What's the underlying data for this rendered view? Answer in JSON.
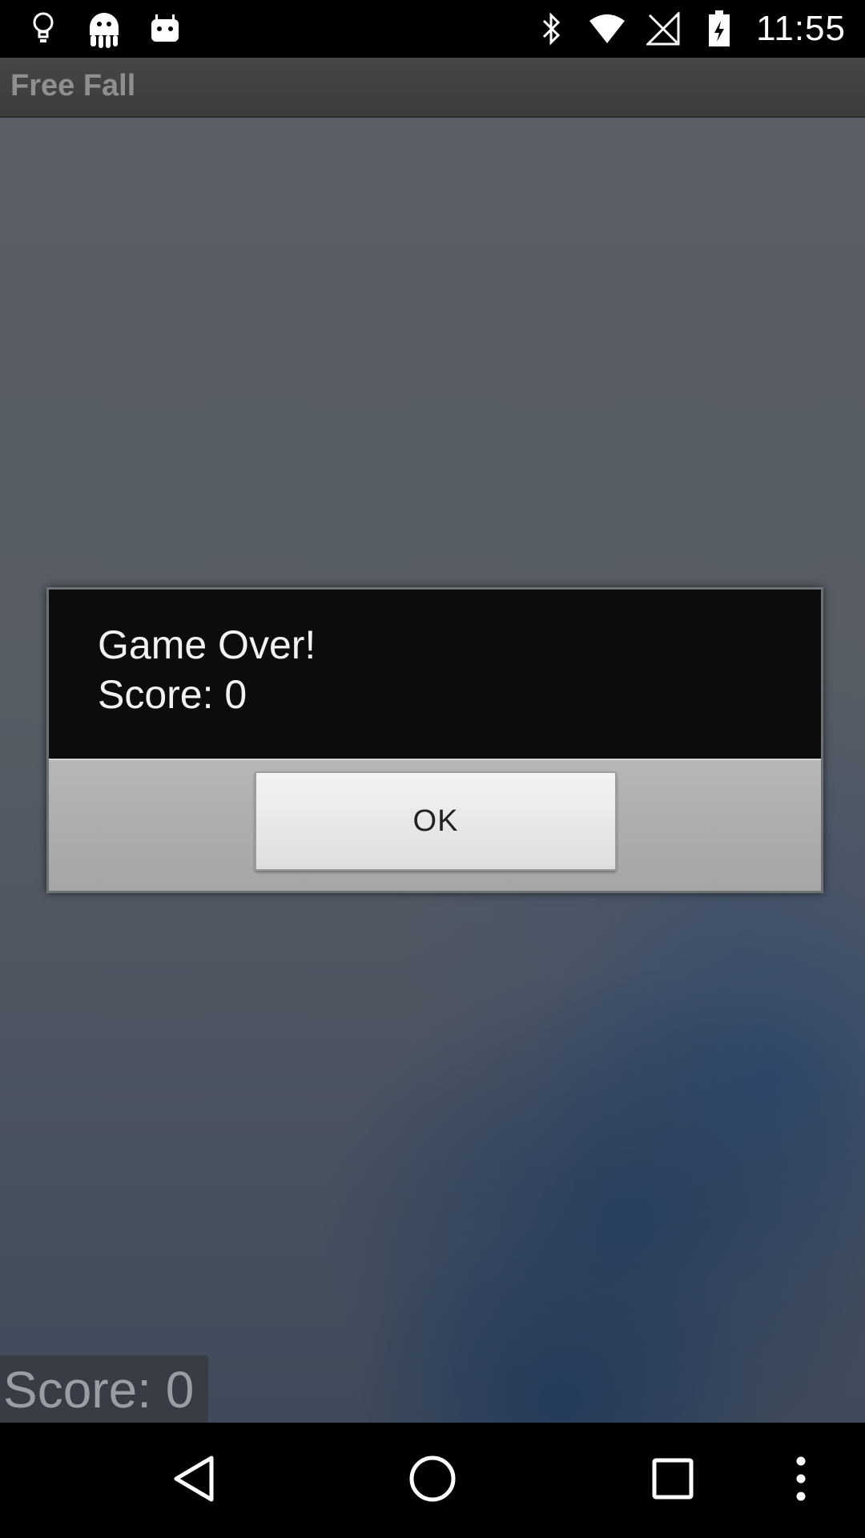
{
  "status_bar": {
    "time": "11:55",
    "left_icons": [
      "lightbulb-icon",
      "ghost-icon",
      "android-icon"
    ],
    "right_icons": [
      "bluetooth-icon",
      "wifi-icon",
      "signal-off-icon",
      "battery-charging-icon"
    ]
  },
  "action_bar": {
    "title": "Free Fall"
  },
  "game": {
    "score_label": "Score: 0"
  },
  "dialog": {
    "line1": "Game Over!",
    "line2": "Score: 0",
    "ok_label": "OK"
  },
  "nav_bar": {
    "buttons": [
      "back-icon",
      "home-icon",
      "recents-icon",
      "menu-icon"
    ]
  },
  "colors": {
    "status_bar": "#000000",
    "action_bar": "#3f4141",
    "title_text": "#8e9090",
    "dialog_body": "#0b0c0d",
    "dialog_footer": "#aeb0b2"
  }
}
